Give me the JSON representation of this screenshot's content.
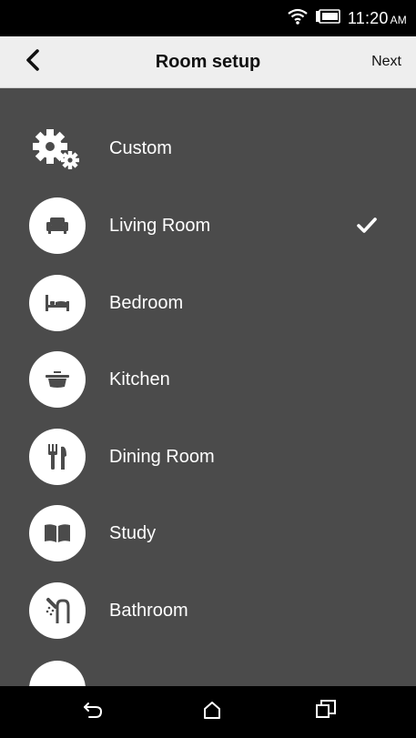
{
  "status_bar": {
    "time": "11:20",
    "ampm": "AM",
    "icons": [
      "wifi-icon",
      "battery-icon"
    ]
  },
  "header": {
    "back_icon": "chevron-left-icon",
    "title": "Room setup",
    "next_label": "Next"
  },
  "rooms": [
    {
      "label": "Custom",
      "icon": "gears-icon",
      "selected": false
    },
    {
      "label": "Living Room",
      "icon": "sofa-icon",
      "selected": true
    },
    {
      "label": "Bedroom",
      "icon": "bed-icon",
      "selected": false
    },
    {
      "label": "Kitchen",
      "icon": "pot-icon",
      "selected": false
    },
    {
      "label": "Dining Room",
      "icon": "fork-knife-icon",
      "selected": false
    },
    {
      "label": "Study",
      "icon": "book-icon",
      "selected": false
    },
    {
      "label": "Bathroom",
      "icon": "shower-icon",
      "selected": false
    }
  ],
  "nav_bar": {
    "icons": [
      "back-icon",
      "home-icon",
      "recent-apps-icon"
    ]
  },
  "colors": {
    "status_bar_bg": "#000000",
    "app_bar_bg": "#eeeeee",
    "list_bg": "#4b4b4b",
    "nav_bar_bg": "#000000",
    "text_light": "#ffffff"
  }
}
